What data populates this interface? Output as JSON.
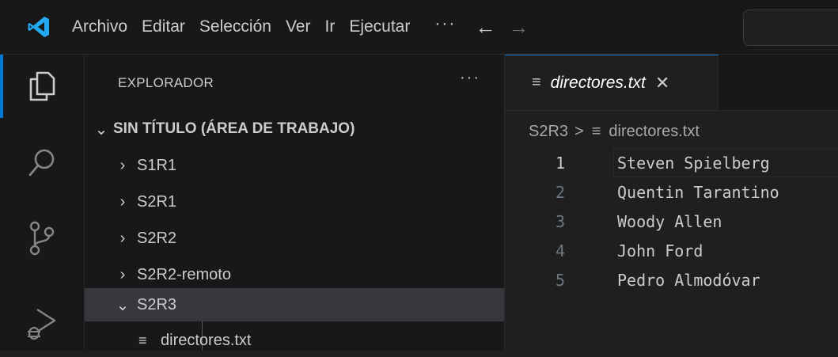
{
  "titlebar": {
    "menu": [
      "Archivo",
      "Editar",
      "Selección",
      "Ver",
      "Ir",
      "Ejecutar"
    ],
    "more": "···",
    "back_arrow": "←",
    "forward_arrow": "→"
  },
  "activity_bar": {
    "items": [
      "explorer-icon",
      "search-icon",
      "source-control-icon",
      "run-debug-icon"
    ],
    "active": "explorer-icon",
    "accent": "#0078d4"
  },
  "sidebar": {
    "title": "EXPLORADOR",
    "more": "···",
    "workspace": "SIN TÍTULO (ÁREA DE TRABAJO)",
    "folders": [
      "S1R1",
      "S2R1",
      "S2R2",
      "S2R2-remoto",
      "S2R3"
    ],
    "expanded_folder": "S2R3",
    "file": "directores.txt"
  },
  "editor": {
    "tab": {
      "label": "directores.txt",
      "close": "✕"
    },
    "breadcrumbs": {
      "folder": "S2R3",
      "separator": ">",
      "file": "directores.txt"
    },
    "lines": [
      {
        "number": "1",
        "text": "Steven Spielberg"
      },
      {
        "number": "2",
        "text": "Quentin Tarantino"
      },
      {
        "number": "3",
        "text": "Woody Allen"
      },
      {
        "number": "4",
        "text": "John Ford"
      },
      {
        "number": "5",
        "text": "Pedro Almodóvar"
      }
    ]
  },
  "colors": {
    "background": "#1f1f1f",
    "sidebar": "#181818",
    "selection": "#37373d",
    "accent": "#0078d4",
    "logo": "#23a9f2"
  }
}
